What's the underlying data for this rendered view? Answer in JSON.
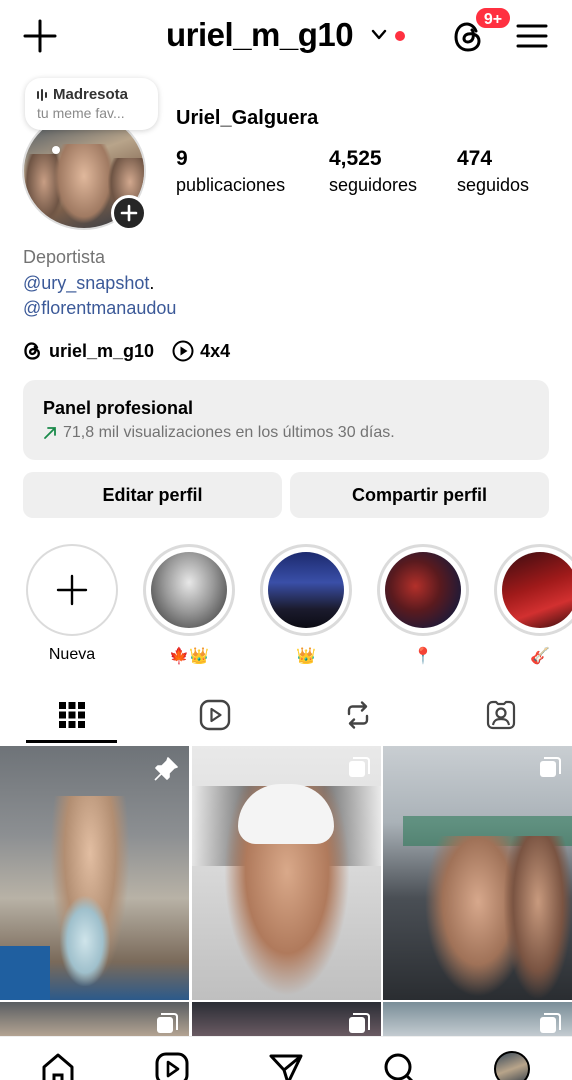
{
  "header": {
    "username": "uriel_m_g10",
    "notification_badge": "9+",
    "icons": [
      "plus-icon",
      "chevron-down-icon",
      "threads-icon",
      "hamburger-menu-icon"
    ],
    "accent_red": "#ff3040"
  },
  "note": {
    "title": "Madresota",
    "subtitle": "tu meme fav..."
  },
  "profile": {
    "full_name": "Uriel_Galguera",
    "stats": [
      {
        "value": "9",
        "label": "publicaciones"
      },
      {
        "value": "4,525",
        "label": "seguidores"
      },
      {
        "value": "474",
        "label": "seguidos"
      }
    ],
    "category": "Deportista",
    "mentions": [
      "@ury_snapshot",
      "@florentmanaudou"
    ],
    "mention_separator": ".",
    "threads_handle": "uriel_m_g10",
    "play_text": "4x4",
    "link_color": "#3b5998"
  },
  "panel": {
    "title": "Panel profesional",
    "subtitle": "71,8 mil visualizaciones en los últimos 30 días."
  },
  "buttons": {
    "edit": "Editar perfil",
    "share": "Compartir perfil"
  },
  "highlights": [
    {
      "label": "Nueva"
    },
    {
      "label": "🍁👑"
    },
    {
      "label": "👑"
    },
    {
      "label": "📍"
    },
    {
      "label": "🎸"
    }
  ],
  "tabs": [
    "grid-icon",
    "reels-icon",
    "reposts-icon",
    "tagged-icon"
  ],
  "grid_icons": [
    "pin-icon",
    "carousel-icon",
    "carousel-icon",
    "carousel-icon",
    "carousel-icon",
    "carousel-icon"
  ],
  "bottom_nav": [
    "home-icon",
    "reels-icon",
    "send-icon",
    "search-icon",
    "profile-avatar"
  ]
}
